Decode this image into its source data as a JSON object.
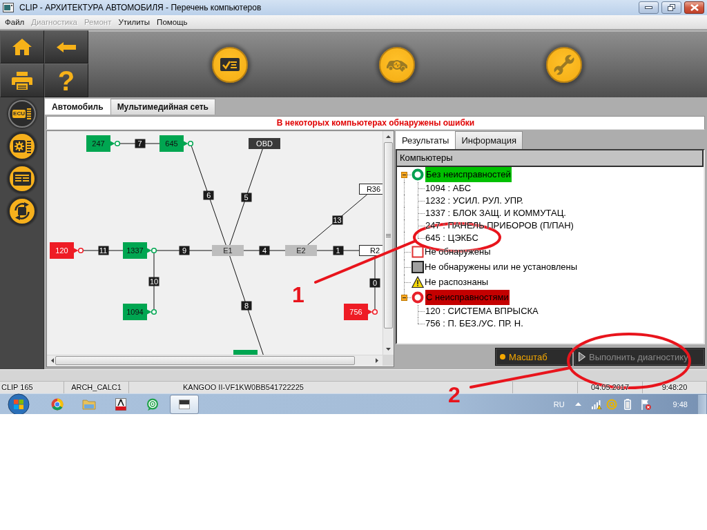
{
  "window": {
    "title": "CLIP - АРХИТЕКТУРА АВТОМОБИЛЯ - Перечень компьютеров"
  },
  "menu": [
    {
      "label": "Файл",
      "disabled": false
    },
    {
      "label": "Диагностика",
      "disabled": true
    },
    {
      "label": "Ремонт",
      "disabled": true
    },
    {
      "label": "Утилиты",
      "disabled": false
    },
    {
      "label": "Помощь",
      "disabled": false
    }
  ],
  "quick_buttons": [
    {
      "kind": "home"
    },
    {
      "kind": "back"
    },
    {
      "kind": "print"
    },
    {
      "kind": "help",
      "glyph": "?"
    }
  ],
  "mode_buttons": [
    {
      "kind": "checklist",
      "disabled": false
    },
    {
      "kind": "diagnose",
      "disabled": true
    },
    {
      "kind": "repair",
      "disabled": true
    }
  ],
  "sidebar": [
    {
      "kind": "ecu",
      "text": "ECU",
      "selected": true
    },
    {
      "kind": "settings",
      "selected": false
    },
    {
      "kind": "list",
      "selected": false
    },
    {
      "kind": "exchange",
      "selected": false
    }
  ],
  "tabs": [
    {
      "label": "Автомобиль",
      "selected": true
    },
    {
      "label": "Мультимедийная сеть",
      "selected": false
    }
  ],
  "message": "В некоторых компьютерах обнаружены ошибки",
  "diagram": {
    "nodes": [
      {
        "label": "247",
        "kind": "ok"
      },
      {
        "label": "645",
        "kind": "ok"
      },
      {
        "label": "OBD",
        "kind": "port"
      },
      {
        "label": "R36",
        "kind": "absent"
      },
      {
        "label": "120",
        "kind": "error"
      },
      {
        "label": "1337",
        "kind": "ok"
      },
      {
        "label": "E1",
        "kind": "bus"
      },
      {
        "label": "E2",
        "kind": "bus"
      },
      {
        "label": "R2",
        "kind": "absent"
      },
      {
        "label": "1094",
        "kind": "ok"
      },
      {
        "label": "756",
        "kind": "error"
      },
      {
        "kind": "ok"
      }
    ],
    "links": [
      {
        "label": "7"
      },
      {
        "label": "6"
      },
      {
        "label": "5"
      },
      {
        "label": "13"
      },
      {
        "label": "11"
      },
      {
        "label": "9"
      },
      {
        "label": "4"
      },
      {
        "label": "1"
      },
      {
        "label": "10"
      },
      {
        "label": "8"
      },
      {
        "label": "0"
      }
    ]
  },
  "result_tabs": [
    {
      "label": "Результаты",
      "selected": true
    },
    {
      "label": "Информация",
      "selected": false
    }
  ],
  "tree": {
    "header": "Компьютеры",
    "items": [
      {
        "label": "Без неисправностей",
        "kind": "healthy",
        "expanded": true,
        "children": [
          {
            "label": "1094 : АБС"
          },
          {
            "label": "1232 : УСИЛ. РУЛ. УПР."
          },
          {
            "label": "1337 : БЛОК ЗАЩ. И КОММУТАЦ."
          },
          {
            "label": "247 : ПАНЕЛЬ ПРИБОРОВ (П/ПАН)"
          },
          {
            "label": "645 : ЦЭКБС"
          }
        ]
      },
      {
        "label": "Не обнаружены",
        "kind": "missing"
      },
      {
        "label": "Не обнаружены или не установлены",
        "kind": "absent"
      },
      {
        "label": "Не распознаны",
        "kind": "unknown"
      },
      {
        "label": "С неисправностями",
        "kind": "faulty",
        "expanded": true,
        "children": [
          {
            "label": "120 : СИСТЕМА ВПРЫСКА"
          },
          {
            "label": "756 : П. БЕЗ./УС. ПР. Н."
          }
        ]
      }
    ]
  },
  "actions": [
    {
      "kind": "scale",
      "label": "Масштаб",
      "disabled": false
    },
    {
      "kind": "run",
      "label": "Выполнить диагностику",
      "disabled": true
    }
  ],
  "status_bar": [
    "CLIP 165",
    "ARCH_CALC1",
    "KANGOO II-VF1KW0BB541722225",
    "04.05.2017",
    "9:48:20"
  ],
  "taskbar": {
    "apps": [
      {
        "kind": "browser",
        "selected": false
      },
      {
        "kind": "folder",
        "selected": false
      },
      {
        "kind": "cad",
        "selected": false
      },
      {
        "kind": "messenger",
        "selected": false
      },
      {
        "kind": "window",
        "selected": true
      }
    ],
    "language": "RU",
    "clock": "9:48"
  },
  "annotations": [
    {
      "label": "1"
    },
    {
      "label": "2"
    }
  ]
}
